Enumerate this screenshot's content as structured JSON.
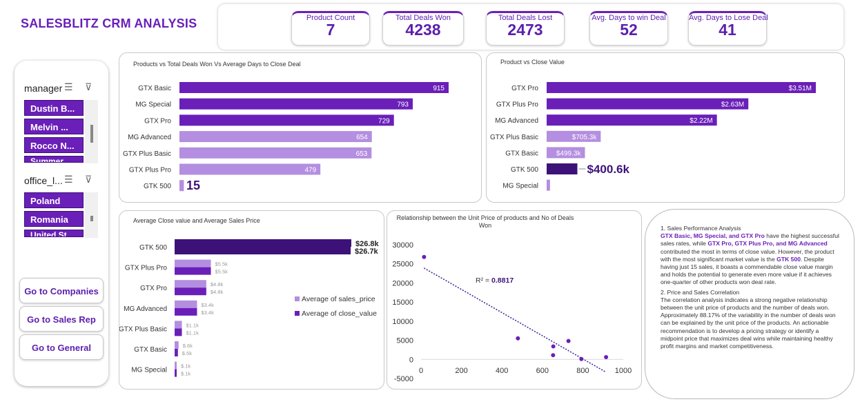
{
  "header": {
    "title": "SALESBLITZ CRM ANALYSIS"
  },
  "kpis": [
    {
      "label": "Product Count",
      "value": "7"
    },
    {
      "label": "Total Deals Won",
      "value": "4238"
    },
    {
      "label": "Total Deals Lost",
      "value": "2473"
    },
    {
      "label": "Avg. Days to win Deal",
      "value": "52"
    },
    {
      "label": "Avg. Days to Lose Deal",
      "value": "41"
    }
  ],
  "slicers": {
    "manager": {
      "title": "manager",
      "items": [
        "Dustin B...",
        "Melvin ...",
        "Rocco N...",
        "Summer..."
      ]
    },
    "office": {
      "title": "office_l...",
      "items": [
        "Poland",
        "Romania",
        "United St..."
      ]
    }
  },
  "nav": {
    "companies": "Go to Companies",
    "sales_rep": "Go to Sales Rep",
    "general": "Go to General"
  },
  "colors": {
    "accent": "#6a1fb8",
    "light": "#b48ee0",
    "dark": "#3d1278",
    "mid": "#7a35c4"
  },
  "chart_data": [
    {
      "type": "bar",
      "title": "Products vs Total Deals Won Vs Average Days to Close Deal",
      "categories": [
        "GTX Basic",
        "MG Special",
        "GTX Pro",
        "MG Advanced",
        "GTX Plus Basic",
        "GTX Plus Pro",
        "GTK 500"
      ],
      "values": [
        915,
        793,
        729,
        654,
        653,
        479,
        15
      ],
      "labels": [
        "915",
        "793",
        "729",
        "654",
        "653",
        "479",
        "15"
      ],
      "orientation": "horizontal"
    },
    {
      "type": "bar",
      "title": "Product vs Close Value",
      "categories": [
        "GTX Pro",
        "GTX Plus Pro",
        "MG Advanced",
        "GTX Plus Basic",
        "GTX Basic",
        "GTK 500",
        "MG Special"
      ],
      "values": [
        3510000,
        2630000,
        2220000,
        705300,
        499300,
        400600,
        43800
      ],
      "labels": [
        "$3.51M",
        "$2.63M",
        "$2.22M",
        "$705.3k",
        "$499.3k",
        "$400.6k",
        ""
      ],
      "orientation": "horizontal"
    },
    {
      "type": "bar",
      "title": "Average Close value and Average Sales Price",
      "categories": [
        "GTK 500",
        "GTX Plus Pro",
        "GTX Pro",
        "MG Advanced",
        "GTX Plus Basic",
        "GTX Basic",
        "MG Special"
      ],
      "series": [
        {
          "name": "Average of sales_price",
          "values": [
            26800,
            5500,
            4800,
            3400,
            1100,
            600,
            100
          ],
          "labels": [
            "$26.8k",
            "$5.5k",
            "$4.8k",
            "$3.4k",
            "$1.1k",
            "$.6k",
            "$.1k"
          ]
        },
        {
          "name": "Average of close_value",
          "values": [
            26700,
            5500,
            4800,
            3400,
            1100,
            500,
            100
          ],
          "labels": [
            "$26.7k",
            "$5.5k",
            "$4.8k",
            "$3.4k",
            "$1.1k",
            "$.5k",
            "$.1k"
          ]
        }
      ],
      "orientation": "horizontal"
    },
    {
      "type": "scatter",
      "title": "Relationship between the Unit Price of products  and No of Deals Won",
      "x": [
        15,
        479,
        653,
        654,
        729,
        793,
        915
      ],
      "y": [
        26800,
        5500,
        1100,
        3400,
        4800,
        100,
        600
      ],
      "xlim": [
        0,
        1000
      ],
      "ylim": [
        -5000,
        30000
      ],
      "xticks": [
        "0",
        "200",
        "400",
        "600",
        "800",
        "1000"
      ],
      "yticks": [
        "-5000",
        "0",
        "5000",
        "10000",
        "15000",
        "20000",
        "25000",
        "30000"
      ],
      "trendline": {
        "x": [
          15,
          910
        ],
        "y": [
          23900,
          -3200
        ]
      },
      "annotation_label": "R² = ",
      "annotation_value": "0.8817"
    }
  ],
  "insight": {
    "h1": "1. Sales Performance Analysis",
    "p1_bold1": "GTX Basic, MG Special, and GTX Pro",
    "p1_t1": " have the highest successful sales rates, while ",
    "p1_bold2": "GTX Pro, GTX Plus Pro, and MG Advanced",
    "p1_t2": " contributed the most in terms of close value. However, the product with the most significant market value is the ",
    "p1_bold3": "GTK 500",
    "p1_t3": ". Despite having just 15 sales, it boasts a commendable close value margin and holds the potential to generate even more value if it achieves one-quarter of other products won deal rate.",
    "h2": "2. Price and Sales Correlation",
    "p2": "The correlation analysis indicates a strong negative relationship between the unit price of products and the number of deals won. Approximately 88.17% of the variability in the number of deals won can be explained by the unit price of the products. An actionable recommendation is to develop a pricing strategy or identify a midpoint price that maximizes deal wins while maintaining healthy profit margins and market competitiveness."
  }
}
